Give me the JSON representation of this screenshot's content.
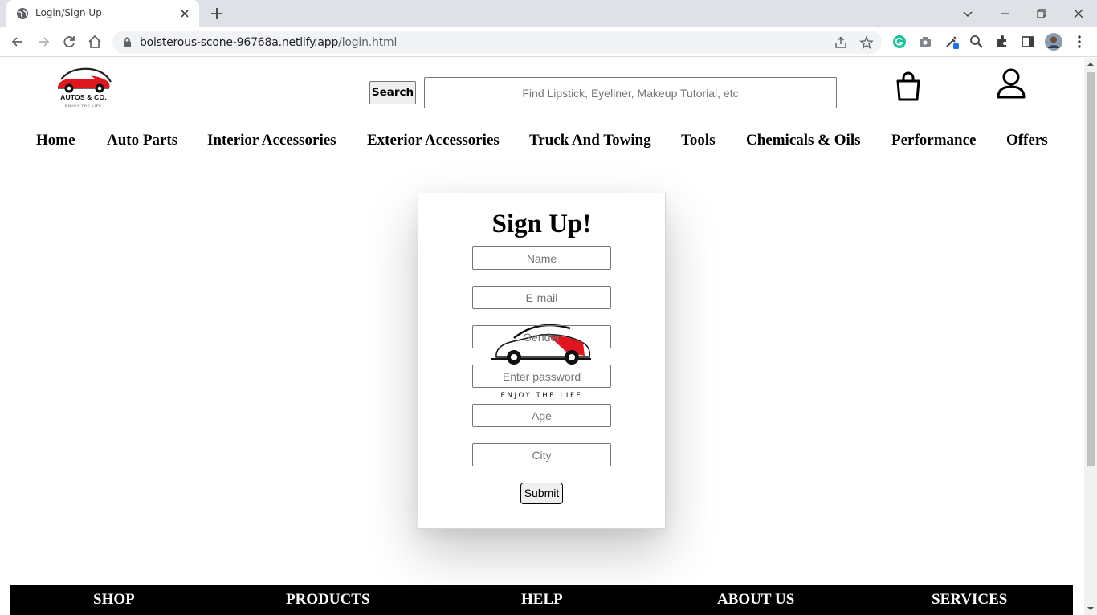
{
  "browser": {
    "tab_title": "Login/Sign Up",
    "url_host": "boisterous-scone-96768a.netlify.app",
    "url_path": "/login.html"
  },
  "header": {
    "logo_name": "AUTOS & CO.",
    "logo_tagline": "ENJOY THE LIFE",
    "search_button": "Search",
    "search_placeholder": "Find Lipstick, Eyeliner, Makeup Tutorial, etc"
  },
  "nav": {
    "items": [
      {
        "label": "Home"
      },
      {
        "label": "Auto Parts"
      },
      {
        "label": "Interior Accessories"
      },
      {
        "label": "Exterior Accessories"
      },
      {
        "label": "Truck And Towing"
      },
      {
        "label": "Tools"
      },
      {
        "label": "Chemicals & Oils"
      },
      {
        "label": "Performance"
      },
      {
        "label": "Offers"
      }
    ]
  },
  "signup": {
    "title": "Sign Up!",
    "name_placeholder": "Name",
    "email_placeholder": "E-mail",
    "gender_placeholder": "Gender",
    "password_placeholder": "Enter password",
    "age_placeholder": "Age",
    "city_placeholder": "City",
    "logo_tagline": "ENJOY THE LIFE",
    "submit_label": "Submit"
  },
  "footer": {
    "items": [
      {
        "label": "SHOP"
      },
      {
        "label": "PRODUCTS"
      },
      {
        "label": "HELP"
      },
      {
        "label": "ABOUT US"
      },
      {
        "label": "SERVICES"
      }
    ]
  },
  "colors": {
    "brand_red": "#e0161e",
    "footer_bg": "#000000",
    "chrome_bg": "#dee1e6"
  },
  "icons": {
    "bag": "shopping-bag-icon",
    "user": "user-icon"
  }
}
